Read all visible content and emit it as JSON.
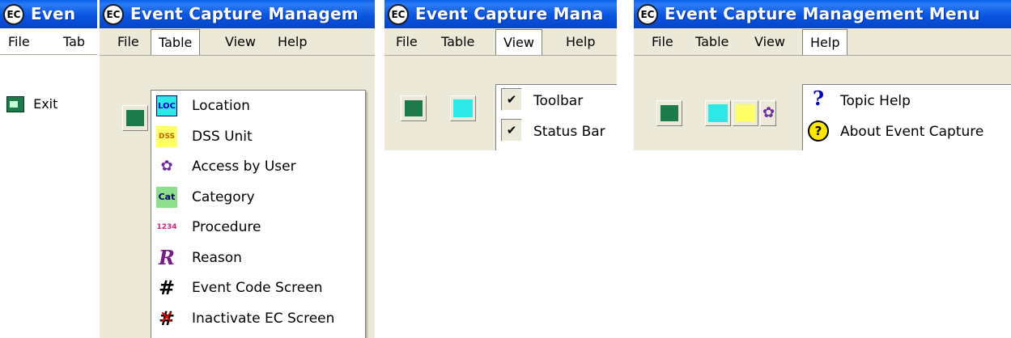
{
  "app": {
    "title": "Event Capture Management Menu",
    "title_p1": "Even",
    "title_p2": "Event Capture Managem",
    "title_p3": "Event Capture Mana",
    "title_p4": "Event Capture Management Menu",
    "logo_text": "EC"
  },
  "menubar": {
    "file": "File",
    "table": "Table",
    "table_short": "Tab",
    "view": "View",
    "help": "Help"
  },
  "file_menu": {
    "exit": "Exit"
  },
  "table_menu": {
    "items": [
      {
        "label": "Location",
        "icon": "location-icon",
        "icon_text": "LOC"
      },
      {
        "label": "DSS Unit",
        "icon": "dss-unit-icon",
        "icon_text": "DSS"
      },
      {
        "label": "Access by User",
        "icon": "access-user-icon",
        "icon_text": ""
      },
      {
        "label": "Category",
        "icon": "category-icon",
        "icon_text": "Cat"
      },
      {
        "label": "Procedure",
        "icon": "procedure-icon",
        "icon_text": "1234"
      },
      {
        "label": "Reason",
        "icon": "reason-icon",
        "icon_text": "R"
      },
      {
        "label": "Event Code Screen",
        "icon": "grid-icon",
        "icon_text": "#"
      },
      {
        "label": "Inactivate EC Screen",
        "icon": "inactive-grid-icon",
        "icon_text": "#"
      }
    ]
  },
  "view_menu": {
    "toolbar": "Toolbar",
    "status_bar": "Status Bar",
    "check": "✔"
  },
  "help_menu": {
    "topic_help": "Topic Help",
    "about": "About Event Capture",
    "q": "?"
  },
  "colors": {
    "title_blue": "#0a55e0",
    "menu_bg": "#ece9d8",
    "loc_cyan": "#2ee8e8",
    "dss_yellow": "#ffff66"
  }
}
